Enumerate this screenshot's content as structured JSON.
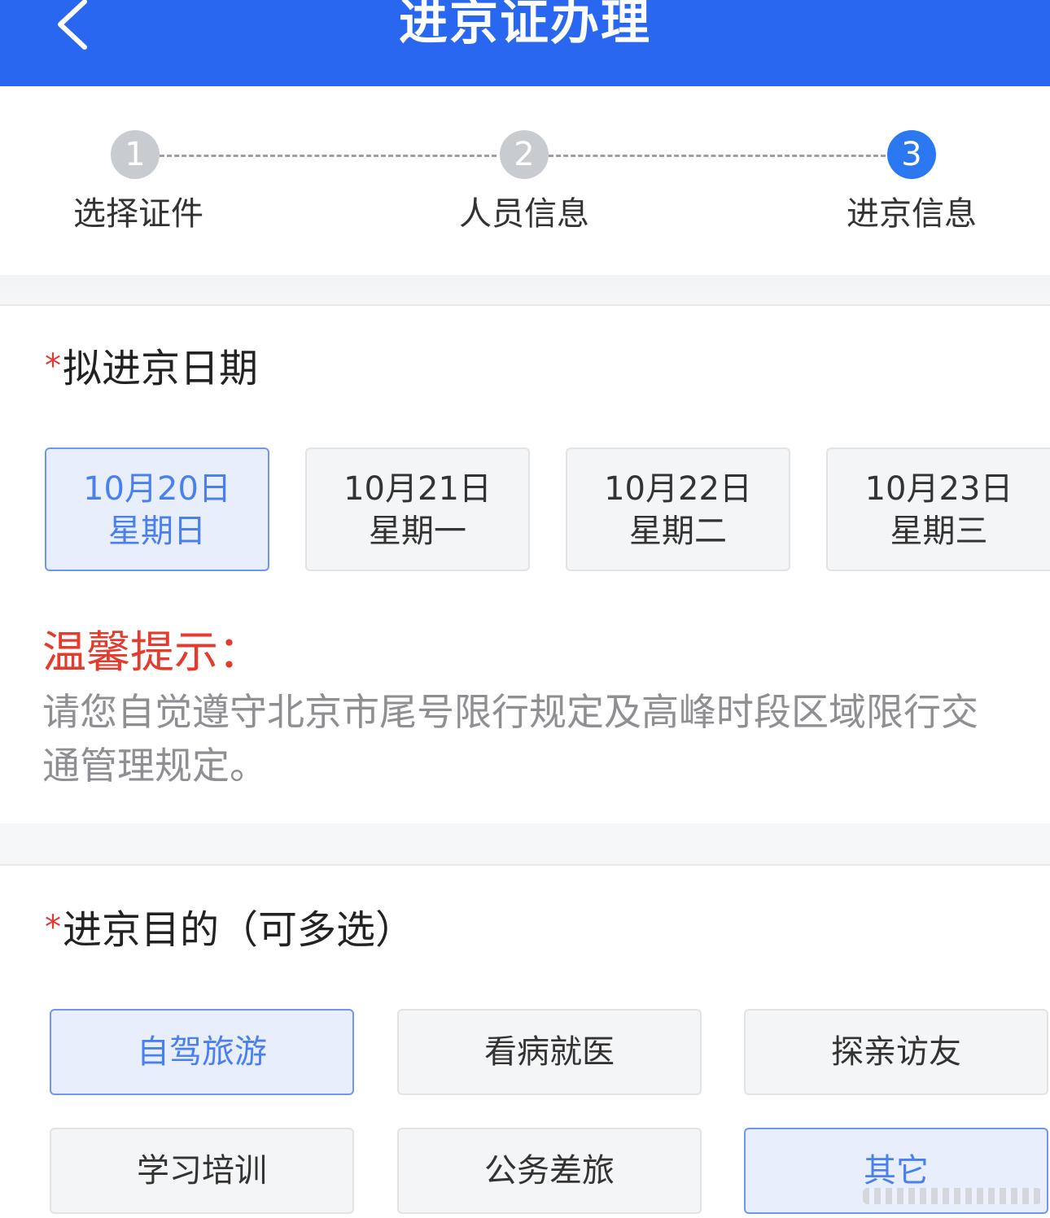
{
  "header": {
    "title": "进京证办理",
    "back_icon": "chevron-left-icon",
    "background": "#2a67f0"
  },
  "steps": [
    {
      "number": "1",
      "label": "选择证件",
      "state": "completed"
    },
    {
      "number": "2",
      "label": "人员信息",
      "state": "completed"
    },
    {
      "number": "3",
      "label": "进京信息",
      "state": "active"
    }
  ],
  "date_section": {
    "required_mark": "*",
    "title": "拟进京日期",
    "dates": [
      {
        "date": "10月20日",
        "weekday": "星期日",
        "selected": true
      },
      {
        "date": "10月21日",
        "weekday": "星期一",
        "selected": false
      },
      {
        "date": "10月22日",
        "weekday": "星期二",
        "selected": false
      },
      {
        "date": "10月23日",
        "weekday": "星期三",
        "selected": false
      }
    ]
  },
  "tip": {
    "title": "温馨提示：",
    "body": "请您自觉遵守北京市尾号限行规定及高峰时段区域限行交通管理规定。"
  },
  "purpose_section": {
    "required_mark": "*",
    "title": "进京目的（可多选）",
    "options": [
      {
        "label": "自驾旅游",
        "selected": true
      },
      {
        "label": "看病就医",
        "selected": false
      },
      {
        "label": "探亲访友",
        "selected": false
      },
      {
        "label": "学习培训",
        "selected": false
      },
      {
        "label": "公务差旅",
        "selected": false
      },
      {
        "label": "其它",
        "selected": true
      }
    ]
  },
  "colors": {
    "accent": "#2b78f1",
    "selected_text": "#4a80ee",
    "selected_bg": "#e8eefc",
    "tip_title": "#e33b2e",
    "required": "#e53935"
  }
}
